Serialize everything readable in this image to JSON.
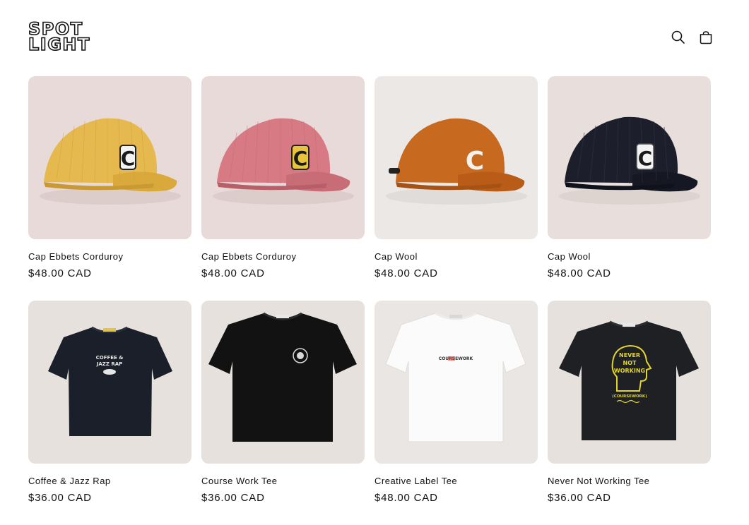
{
  "header": {
    "logo_line1": "SPOT",
    "logo_line2": "LIGHT",
    "search_icon": "search-icon",
    "cart_icon": "cart-icon"
  },
  "products": [
    {
      "title": "Cap Ebbets Corduroy",
      "price": "$48.00 CAD"
    },
    {
      "title": "Cap Ebbets Corduroy",
      "price": "$48.00 CAD"
    },
    {
      "title": "Cap Wool",
      "price": "$48.00 CAD"
    },
    {
      "title": "Cap Wool",
      "price": "$48.00 CAD"
    },
    {
      "title": "Coffee & Jazz Rap",
      "price": "$36.00 CAD"
    },
    {
      "title": "Course Work Tee",
      "price": "$36.00 CAD"
    },
    {
      "title": "Creative Label Tee",
      "price": "$48.00 CAD"
    },
    {
      "title": "Never Not Working Tee",
      "price": "$36.00 CAD"
    }
  ],
  "graphics": {
    "tee_label_coffee": "COFFEE &",
    "tee_label_jazz": "JAZZ RAP",
    "tee_label_creative": "COURSEWORK",
    "tee_label_never1": "NEVER",
    "tee_label_never2": "NOT",
    "tee_label_never3": "WORKING",
    "tee_label_never4": "(COURSEWORK)"
  },
  "colors": {
    "text": "#121212",
    "cap_yellow": "#e6b94e",
    "cap_pink": "#d77a83",
    "cap_orange": "#c7691f",
    "cap_navy": "#1c1f2b",
    "print_yellow": "#e2d42a"
  }
}
